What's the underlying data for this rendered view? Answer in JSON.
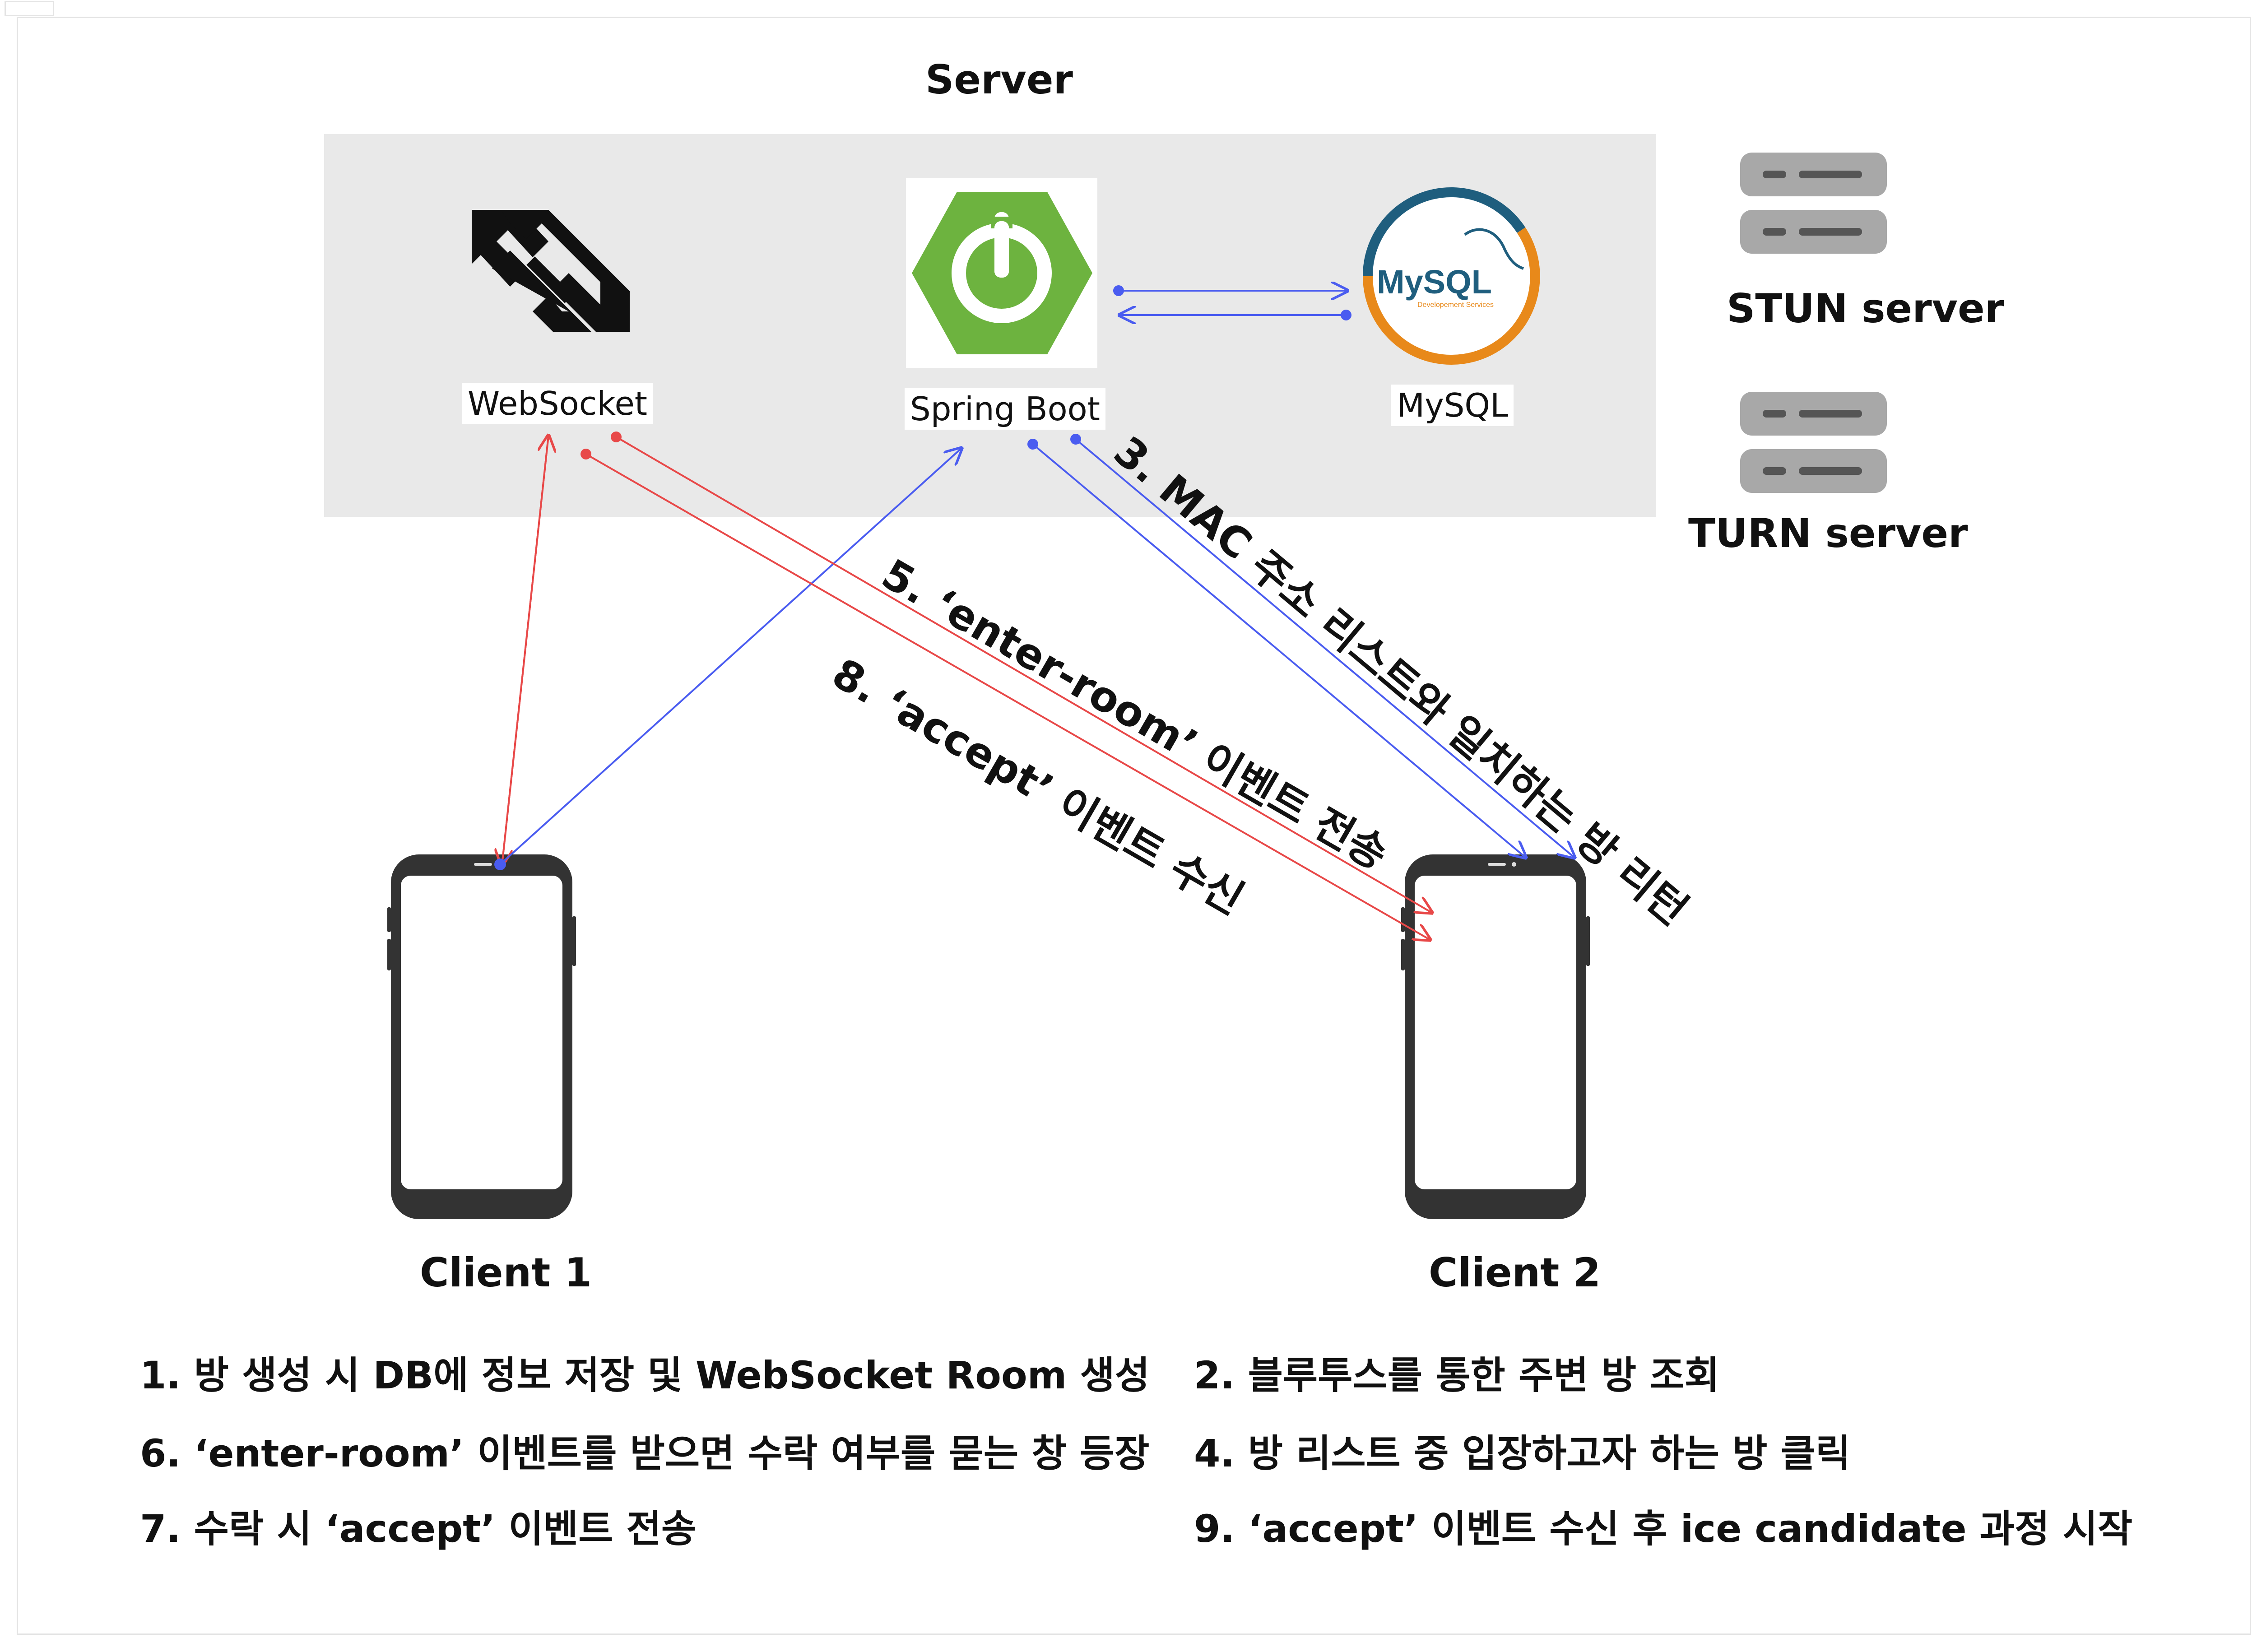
{
  "server": {
    "title": "Server"
  },
  "nodes": {
    "websocket": "WebSocket",
    "spring_boot": "Spring Boot",
    "mysql": "MySQL",
    "stun": "STUN server",
    "turn": "TURN server"
  },
  "mysql_logo": {
    "text": "MySQL",
    "subtext": "Developement Services"
  },
  "clients": {
    "client1": "Client 1",
    "client2": "Client 2"
  },
  "edge_labels": {
    "step3": "3. MAC 주소 리스트와 일치하는 방 리턴",
    "step5": "5. ‘enter-room’ 이벤트 전송",
    "step8": "8. ‘accept’ 이벤트 수신"
  },
  "steps": {
    "s1": "1. 방 생성 시 DB에 정보 저장 및 WebSocket Room 생성",
    "s2": "2. 블루투스를 통한 주변 방 조회",
    "s4": "4. 방 리스트 중 입장하고자 하는 방 클릭",
    "s6": "6. ‘enter-room’ 이벤트를 받으면 수락 여부를 묻는 창 등장",
    "s7": "7. 수락 시 ‘accept’ 이벤트 전송",
    "s9": "9. ‘accept’ 이벤트 수신 후 ice candidate 과정 시작"
  },
  "colors": {
    "red_arrow": "#e84848",
    "blue_arrow": "#4a5cf0",
    "spring_green": "#6db33f",
    "mysql_blue": "#1f5e7e",
    "mysql_orange": "#e8891a"
  }
}
